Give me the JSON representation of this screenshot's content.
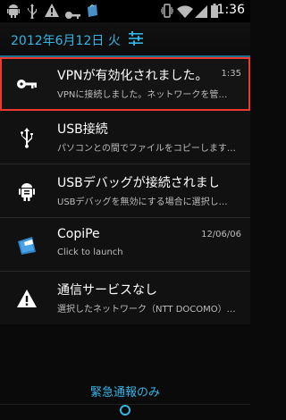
{
  "status_bar": {
    "time": "1:36",
    "left_icons": [
      "android-icon",
      "usb-icon",
      "alert-icon",
      "key-icon",
      "shopping-bag-icon"
    ],
    "right_icons": [
      "vibrate-icon",
      "wifi-icon",
      "signal-icon",
      "battery-icon"
    ]
  },
  "header": {
    "date": "2012年6月12日 火",
    "settings_icon": "settings-icon"
  },
  "notifications": [
    {
      "icon": "key-icon",
      "title": "VPNが有効化されました。",
      "text": "VPNに接続しました。ネットワークを管…",
      "time": "1:35"
    },
    {
      "icon": "usb-icon",
      "title": "USB接続",
      "text": "パソコンとの間でファイルをコピーします…",
      "time": ""
    },
    {
      "icon": "android-debug-icon",
      "title": "USBデバッグが接続されました",
      "text": "USBデバッグを無効にする場合に選択し…",
      "time": ""
    },
    {
      "icon": "copipe-app-icon",
      "title": "CopiPe",
      "text": "Click to launch",
      "time": "12/06/06"
    },
    {
      "icon": "warning-icon",
      "title": "通信サービスなし",
      "text": "選択したネットワーク（NTT DOCOMO）…",
      "time": ""
    }
  ],
  "footer": {
    "emergency_label": "緊急通報のみ"
  },
  "colors": {
    "accent": "#33b5e5",
    "highlight_outline": "#ee3a2c"
  }
}
